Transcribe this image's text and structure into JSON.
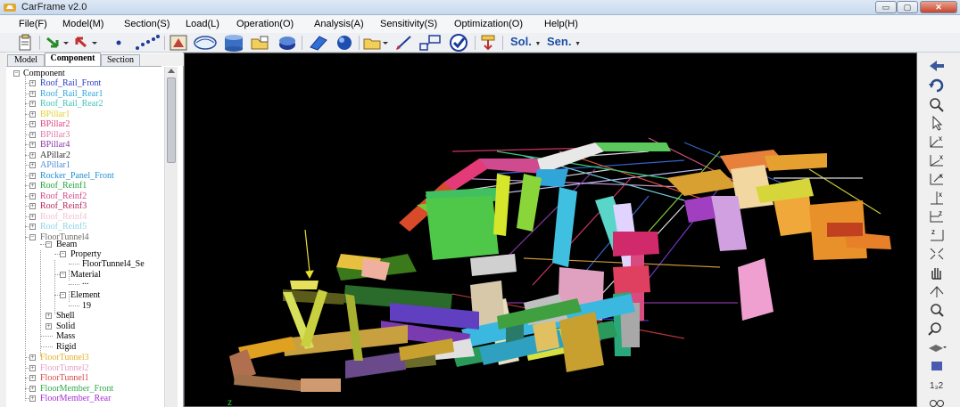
{
  "window": {
    "title": "CarFrame v2.0",
    "minimize": "▭",
    "maximize": "▢",
    "close": "✕"
  },
  "menu": [
    "File(F)",
    "Model(M)",
    "Section(S)",
    "Load(L)",
    "Operation(O)",
    "Analysis(A)",
    "Sensitivity(S)",
    "Optimization(O)",
    "Help(H)"
  ],
  "toolbar": {
    "sol_label": "Sol.",
    "sen_label": "Sen."
  },
  "tabs": [
    "Model",
    "Component",
    "Section"
  ],
  "active_tab": "Component",
  "tree": {
    "root": "Component",
    "items": [
      {
        "label": "Roof_Rail_Front",
        "color": "#2b3cc4"
      },
      {
        "label": "Roof_Rail_Rear1",
        "color": "#2fa6d9"
      },
      {
        "label": "Roof_Rail_Rear2",
        "color": "#3ec3b8"
      },
      {
        "label": "BPillar1",
        "color": "#e0d12a"
      },
      {
        "label": "BPillar2",
        "color": "#e0407a"
      },
      {
        "label": "BPillar3",
        "color": "#e07aa8"
      },
      {
        "label": "BPillar4",
        "color": "#8a3aa6"
      },
      {
        "label": "APillar2",
        "color": "#2b2b2b"
      },
      {
        "label": "APillar1",
        "color": "#4a8fd6"
      },
      {
        "label": "Rocker_Panel_Front",
        "color": "#1f8fd1"
      },
      {
        "label": "Roof_Reinf1",
        "color": "#22a43a"
      },
      {
        "label": "Roof_Reinf2",
        "color": "#d04a8a"
      },
      {
        "label": "Roof_Reinf3",
        "color": "#b4285e"
      },
      {
        "label": "Roof_Reinf4",
        "color": "#f2c4d4"
      },
      {
        "label": "Roof_Reinf5",
        "color": "#8dd3e8"
      },
      {
        "label": "FloorTunnel4",
        "color": "#6b6b6b"
      }
    ],
    "sub": {
      "beam": "Beam",
      "property": "Property",
      "property_value": "FloorTunnel4_Se",
      "material": "Material",
      "material_value": "...",
      "element": "Element",
      "element_value": "19",
      "shell": "Shell",
      "solid": "Solid",
      "mass": "Mass",
      "rigid": "Rigid"
    },
    "after": [
      {
        "label": "FloorTunnel3",
        "color": "#e6b12a"
      },
      {
        "label": "FloorTunnel2",
        "color": "#e6a0c8"
      },
      {
        "label": "FloorTunnel1",
        "color": "#d94a4a"
      },
      {
        "label": "FloorMember_Front",
        "color": "#2faa4a"
      },
      {
        "label": "FloorMember_Rear",
        "color": "#a42ed0"
      }
    ]
  },
  "viewport": {
    "axis_label": "z"
  },
  "colors": {
    "viewport_bg": "#000000",
    "panel_bg": "#ffffff",
    "accent": "#1e4fa3"
  }
}
